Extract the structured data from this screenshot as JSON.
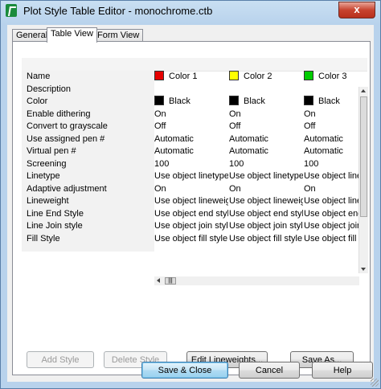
{
  "window": {
    "title": "Plot Style Table Editor - monochrome.ctb",
    "close_glyph": "x"
  },
  "tabs": [
    {
      "label": "General"
    },
    {
      "label": "Table View",
      "active": true
    },
    {
      "label": "Form View"
    }
  ],
  "table": {
    "row_labels": [
      "Name",
      "Description",
      "Color",
      "Enable dithering",
      "Convert to grayscale",
      "Use assigned pen #",
      "Virtual pen #",
      "Screening",
      "Linetype",
      "Adaptive adjustment",
      "Lineweight",
      "Line End Style",
      "Line Join style",
      "Fill Style"
    ],
    "columns": [
      {
        "swatch": "#e60000",
        "cells": [
          "Color 1",
          "",
          "Black",
          "On",
          "Off",
          "Automatic",
          "Automatic",
          "100",
          "Use object linetype",
          "On",
          "Use object lineweight",
          "Use object end style",
          "Use object join style",
          "Use object fill style"
        ]
      },
      {
        "swatch": "#ffff00",
        "cells": [
          "Color 2",
          "",
          "Black",
          "On",
          "Off",
          "Automatic",
          "Automatic",
          "100",
          "Use object linetype",
          "On",
          "Use object lineweight",
          "Use object end style",
          "Use object join style",
          "Use object fill style"
        ]
      },
      {
        "swatch": "#00cc00",
        "cells": [
          "Color 3",
          "",
          "Black",
          "On",
          "Off",
          "Automatic",
          "Automatic",
          "100",
          "Use object linetype",
          "On",
          "Use object lineweight",
          "Use object end style",
          "Use object join style",
          "Use object fill style"
        ]
      }
    ],
    "color_swatch": "#000000"
  },
  "buttons": {
    "add_style": "Add Style",
    "delete_style": "Delete Style",
    "edit_lineweights": "Edit Lineweights...",
    "save_as": "Save As...",
    "save_close": "Save & Close",
    "cancel": "Cancel",
    "help": "Help"
  }
}
